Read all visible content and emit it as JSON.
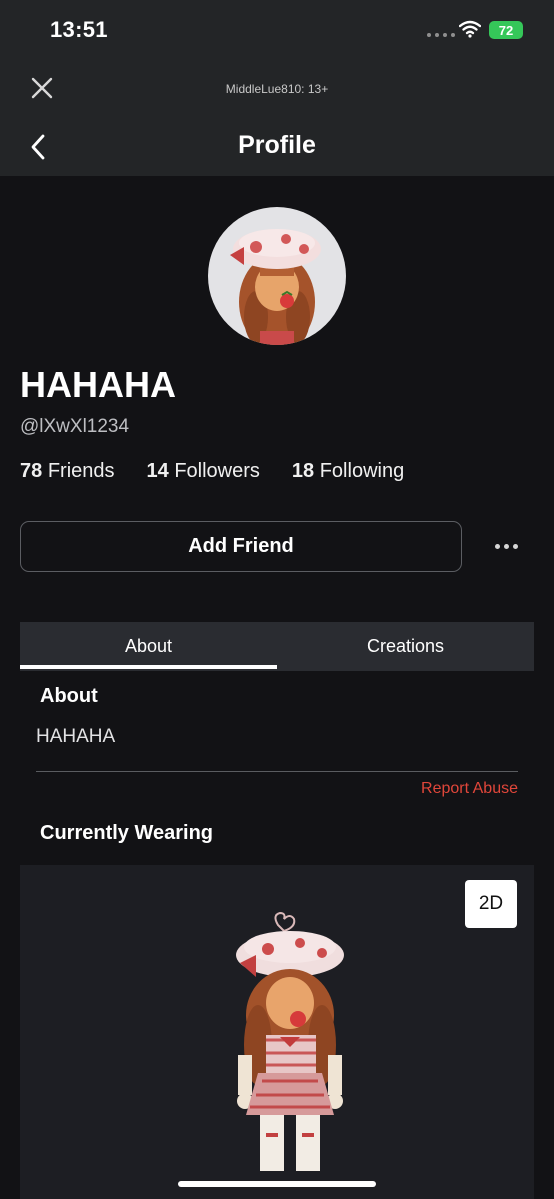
{
  "status": {
    "time": "13:51",
    "battery": "72"
  },
  "window": {
    "subtitle": "MiddleLue810: 13+"
  },
  "header": {
    "title": "Profile"
  },
  "profile": {
    "display_name": "HAHAHA",
    "username": "@lXwXl1234",
    "stats": {
      "friends_count": "78",
      "friends_label": "Friends",
      "followers_count": "14",
      "followers_label": "Followers",
      "following_count": "18",
      "following_label": "Following"
    },
    "add_friend_label": "Add Friend"
  },
  "tabs": [
    {
      "label": "About",
      "active": true
    },
    {
      "label": "Creations",
      "active": false
    }
  ],
  "about": {
    "heading": "About",
    "text": "HAHAHA",
    "report_label": "Report Abuse"
  },
  "wearing": {
    "heading": "Currently Wearing",
    "view_toggle_label": "2D"
  },
  "colors": {
    "background": "#121215",
    "bar": "#232527",
    "battery": "#35c759",
    "report": "#e0463a"
  }
}
